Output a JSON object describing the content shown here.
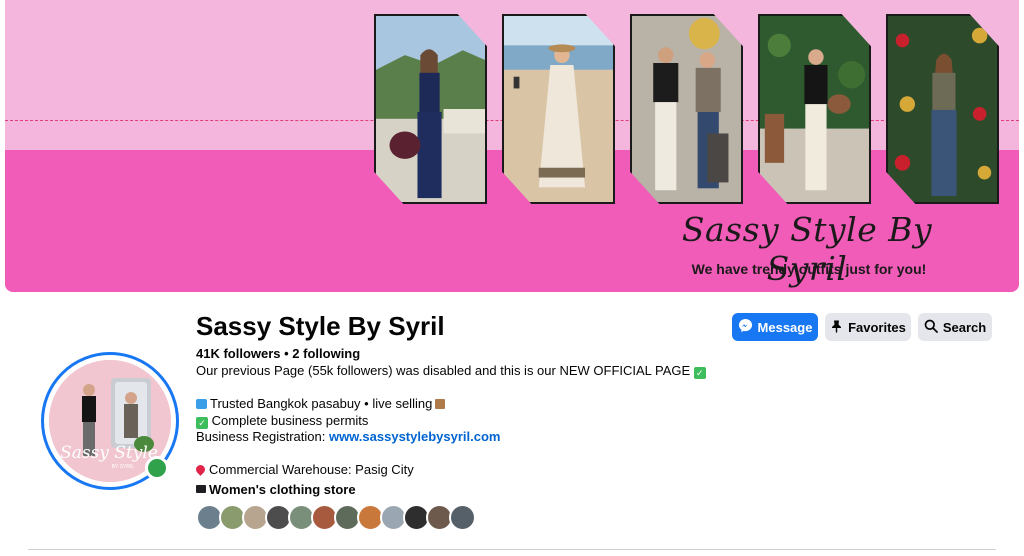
{
  "cover": {
    "brand_script": "Sassy Style By Syril",
    "tagline": "We have trendy outfits just for you!",
    "colors": {
      "top": "#f4b6dc",
      "bottom": "#f05cb8",
      "dash": "#e23c7a"
    },
    "photo_count": 5
  },
  "avatar": {
    "logo_text": "Sassy Style",
    "logo_subtext": "BY SYRIL",
    "online": true
  },
  "profile": {
    "name": "Sassy Style By Syril",
    "stats": "41K followers • 2 following",
    "bio_line1": "Our previous Page (55k followers) was disabled and this is our NEW OFFICIAL PAGE",
    "bio_line2": "Trusted Bangkok pasabuy • live selling",
    "bio_line3": "Complete business permits",
    "bio_line4_prefix": "Business Registration: ",
    "bio_link": "www.sassystylebysyril.com",
    "bio_line5": "Commercial Warehouse: Pasig City",
    "category": "Women's clothing store"
  },
  "actions": {
    "message_label": "Message",
    "favorites_label": "Favorites",
    "search_label": "Search"
  },
  "friends": {
    "count_shown": 12,
    "avatar_icon": "friend-avatar-icon"
  },
  "icons": {
    "messenger": "messenger-icon",
    "favorites": "favorites-icon",
    "search": "search-icon",
    "check": "check-icon",
    "bag": "shopping-bag-icon",
    "box": "package-icon",
    "pin": "location-pin-icon",
    "category": "category-icon"
  },
  "accent_color": "#1877f2"
}
